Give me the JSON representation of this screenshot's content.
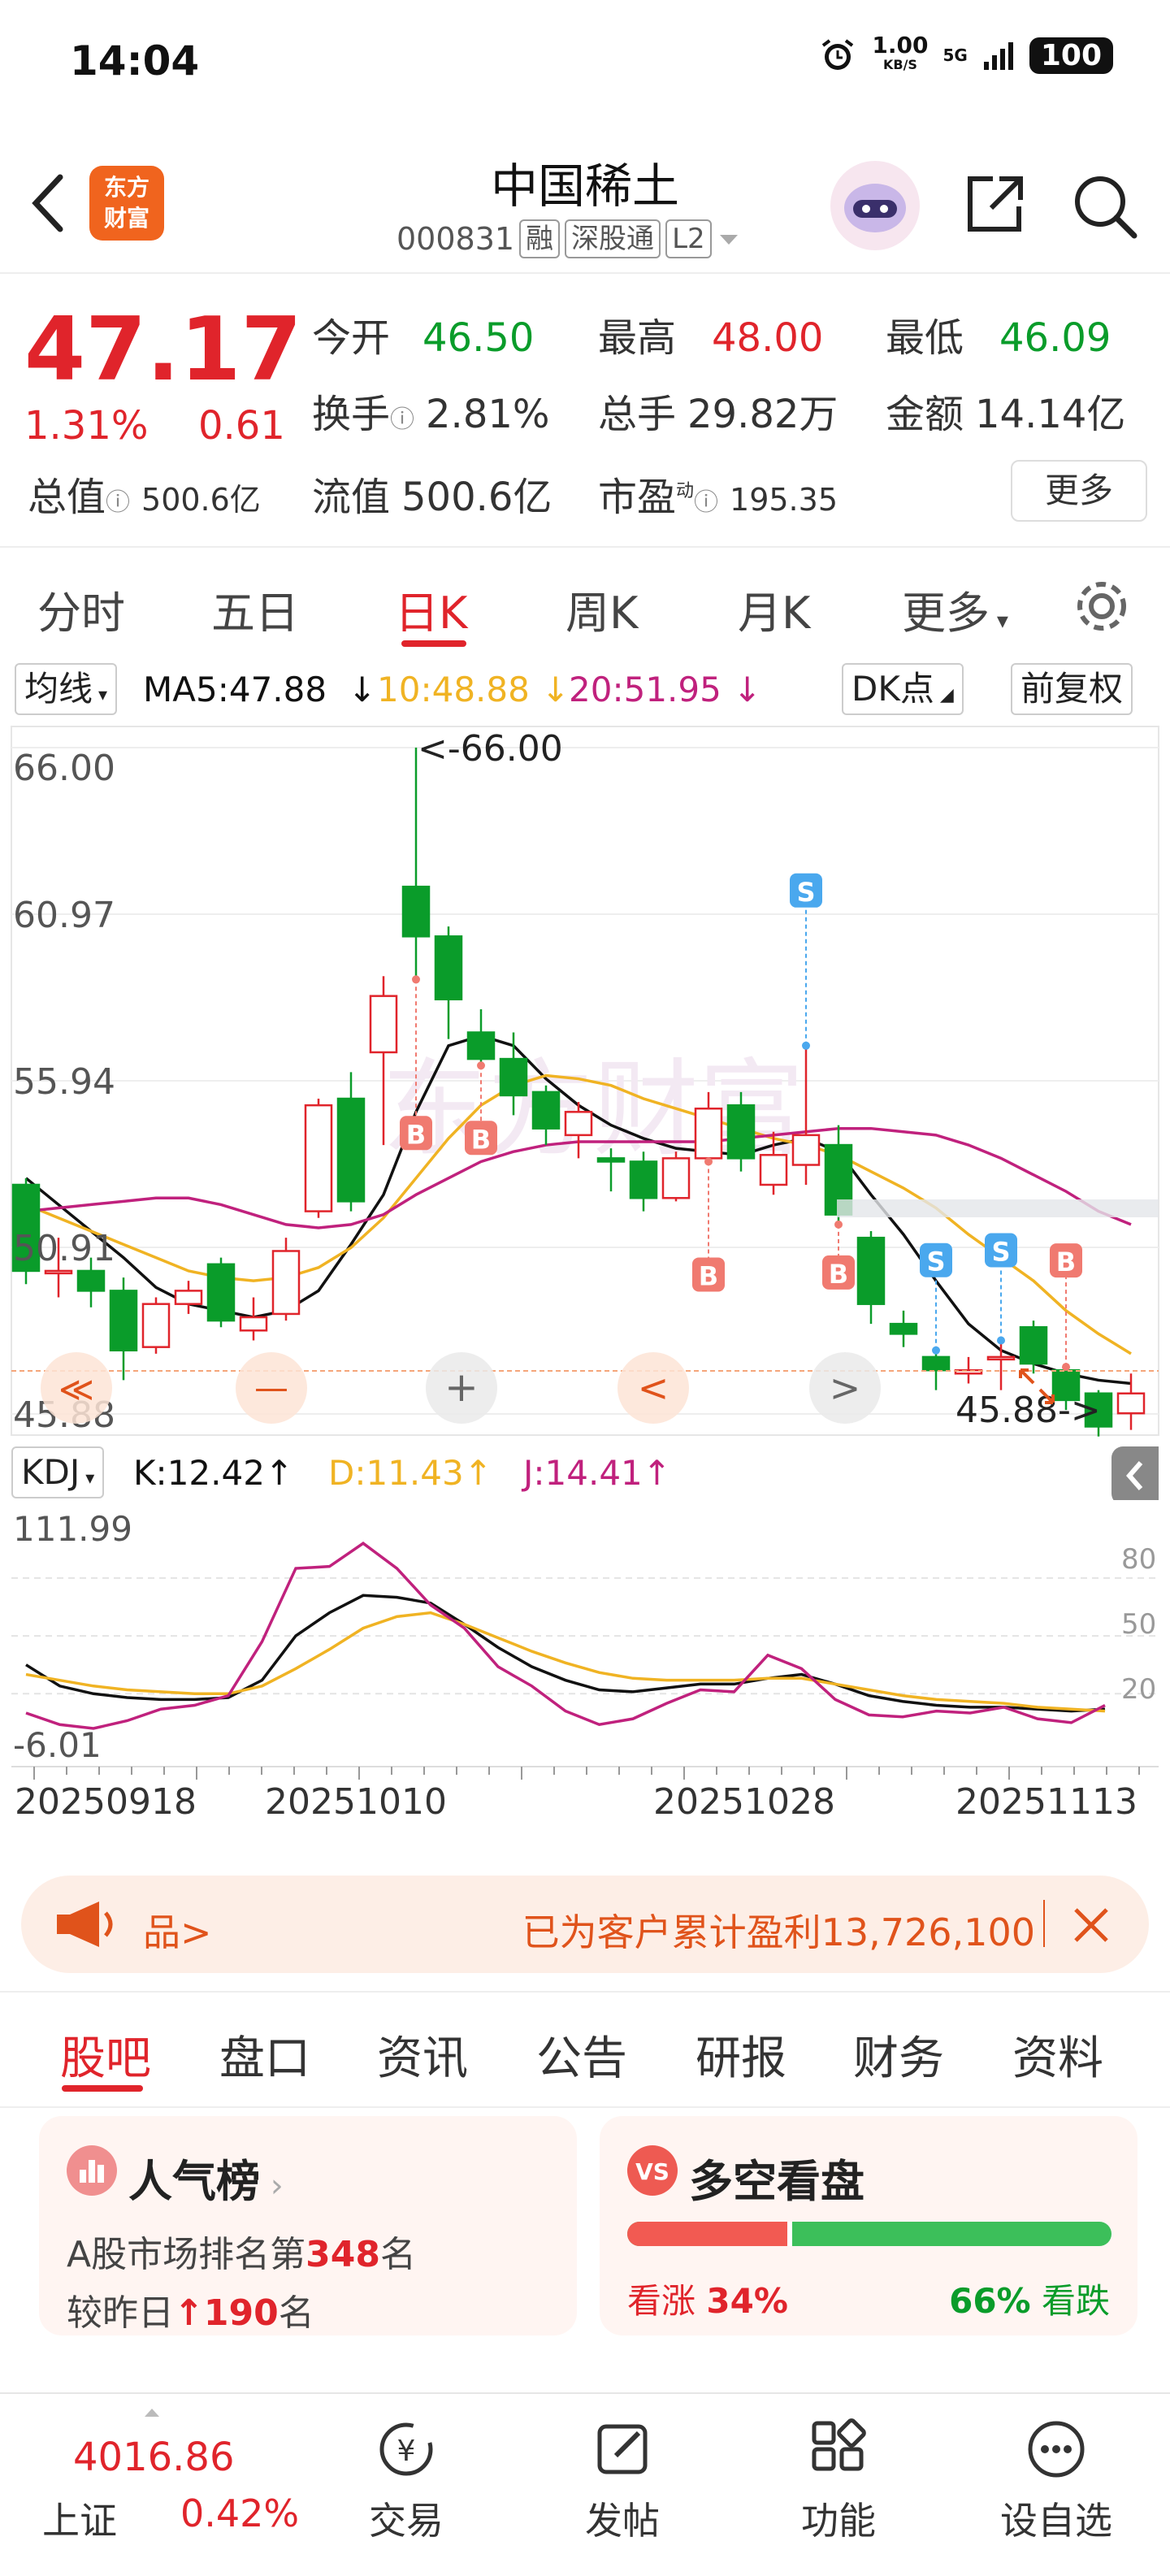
{
  "status_bar": {
    "time": "14:04",
    "net_speed_top": "1.00",
    "net_speed_unit": "KB/S",
    "network": "5G",
    "battery": "100"
  },
  "header": {
    "logo_line1": "东方",
    "logo_line2": "财富",
    "stock_name": "中国稀土",
    "stock_code": "000831",
    "tags": [
      "融",
      "深股通",
      "L2"
    ]
  },
  "quote": {
    "price": "47.17",
    "change_pct": "1.31%",
    "change_amt": "0.61",
    "open_label": "今开",
    "open": "46.50",
    "high_label": "最高",
    "high": "48.00",
    "low_label": "最低",
    "low": "46.09",
    "turnover_label": "换手",
    "turnover": "2.81%",
    "volume_label": "总手",
    "volume": "29.82万",
    "amount_label": "金额",
    "amount": "14.14亿",
    "mktcap_label": "总值",
    "mktcap": "500.6亿",
    "float_label": "流值",
    "float": "500.6亿",
    "pe_label": "市盈",
    "pe_sup": "动",
    "pe": "195.35",
    "more_label": "更多"
  },
  "tabs": [
    "分时",
    "五日",
    "日K",
    "周K",
    "月K",
    "更多"
  ],
  "active_tab": "日K",
  "ma_bar": {
    "dropdown": "均线",
    "ma5": "MA5:47.88",
    "ma10": "10:48.88",
    "ma20": "20:51.95",
    "dk": "DK点",
    "adjust": "前复权"
  },
  "kline": {
    "y_labels": [
      "66.00",
      "60.97",
      "55.94",
      "50.91",
      "45.88"
    ],
    "max_marker": "<-66.00",
    "min_marker": "45.88->",
    "watermark": "东方财富",
    "nav_buttons": [
      "≪",
      "—",
      "+",
      "<",
      ">"
    ]
  },
  "chart_data": [
    {
      "type": "candlestick",
      "title": "",
      "ylim": [
        45.88,
        66.0
      ],
      "dates_shown": [
        "20250918",
        "20251010",
        "20251028",
        "20251113"
      ],
      "candles": [
        {
          "o": 52.8,
          "c": 50.2,
          "h": 53.0,
          "l": 49.8
        },
        {
          "o": 50.2,
          "c": 50.2,
          "h": 51.2,
          "l": 49.4
        },
        {
          "o": 50.2,
          "c": 49.6,
          "h": 50.6,
          "l": 49.1
        },
        {
          "o": 49.6,
          "c": 47.8,
          "h": 50.0,
          "l": 46.9
        },
        {
          "o": 47.9,
          "c": 49.2,
          "h": 49.4,
          "l": 47.7
        },
        {
          "o": 49.2,
          "c": 49.6,
          "h": 49.9,
          "l": 48.9
        },
        {
          "o": 50.4,
          "c": 48.7,
          "h": 50.6,
          "l": 48.5
        },
        {
          "o": 48.4,
          "c": 48.8,
          "h": 49.4,
          "l": 48.1
        },
        {
          "o": 48.9,
          "c": 50.8,
          "h": 51.2,
          "l": 48.7
        },
        {
          "o": 52.0,
          "c": 55.2,
          "h": 55.4,
          "l": 51.8
        },
        {
          "o": 55.4,
          "c": 52.3,
          "h": 56.2,
          "l": 52.0
        },
        {
          "o": 56.8,
          "c": 58.5,
          "h": 59.1,
          "l": 54.0
        },
        {
          "o": 61.8,
          "c": 60.3,
          "h": 66.0,
          "l": 59.0
        },
        {
          "o": 60.3,
          "c": 58.4,
          "h": 60.6,
          "l": 57.2
        },
        {
          "o": 57.4,
          "c": 56.6,
          "h": 58.1,
          "l": 56.4
        },
        {
          "o": 56.6,
          "c": 55.5,
          "h": 57.4,
          "l": 54.9
        },
        {
          "o": 55.6,
          "c": 54.5,
          "h": 55.8,
          "l": 54.0
        },
        {
          "o": 54.3,
          "c": 55.0,
          "h": 55.3,
          "l": 53.6
        },
        {
          "o": 53.6,
          "c": 53.5,
          "h": 53.9,
          "l": 52.6
        },
        {
          "o": 53.5,
          "c": 52.4,
          "h": 53.8,
          "l": 52.0
        },
        {
          "o": 52.4,
          "c": 53.6,
          "h": 53.8,
          "l": 52.3
        },
        {
          "o": 53.6,
          "c": 55.1,
          "h": 55.6,
          "l": 53.5
        },
        {
          "o": 55.2,
          "c": 53.6,
          "h": 55.6,
          "l": 53.2
        },
        {
          "o": 52.8,
          "c": 53.7,
          "h": 54.4,
          "l": 52.5
        },
        {
          "o": 53.4,
          "c": 54.3,
          "h": 57.0,
          "l": 52.8
        },
        {
          "o": 54.0,
          "c": 51.9,
          "h": 54.6,
          "l": 51.6
        },
        {
          "o": 51.2,
          "c": 49.2,
          "h": 51.4,
          "l": 48.6
        },
        {
          "o": 48.6,
          "c": 48.3,
          "h": 49.0,
          "l": 47.9
        },
        {
          "o": 47.6,
          "c": 47.2,
          "h": 47.8,
          "l": 46.6
        },
        {
          "o": 47.1,
          "c": 47.2,
          "h": 47.6,
          "l": 46.8
        },
        {
          "o": 47.6,
          "c": 47.6,
          "h": 48.1,
          "l": 46.6
        },
        {
          "o": 48.5,
          "c": 47.4,
          "h": 48.7,
          "l": 47.1
        },
        {
          "o": 47.2,
          "c": 46.3,
          "h": 47.3,
          "l": 46.0
        },
        {
          "o": 46.5,
          "c": 45.5,
          "h": 46.6,
          "l": 45.2
        },
        {
          "o": 45.9,
          "c": 46.5,
          "h": 47.1,
          "l": 45.4
        }
      ],
      "series": [
        {
          "name": "MA5",
          "color": "#111111",
          "values": [
            53.0,
            52.2,
            51.4,
            50.6,
            49.7,
            49.2,
            49.0,
            48.8,
            49.0,
            49.6,
            51.0,
            52.5,
            55.0,
            57.0,
            57.3,
            57.0,
            56.0,
            55.2,
            54.6,
            54.2,
            53.9,
            53.8,
            53.7,
            54.0,
            54.2,
            53.8,
            52.5,
            51.3,
            49.9,
            48.6,
            47.8,
            47.4,
            47.1,
            46.9,
            46.8
          ]
        },
        {
          "name": "10",
          "color": "#f0b323",
          "values": [
            52.2,
            51.8,
            51.4,
            51.0,
            50.6,
            50.2,
            50.0,
            49.9,
            50.0,
            50.3,
            50.9,
            51.8,
            53.0,
            54.2,
            55.2,
            55.8,
            56.1,
            56.0,
            55.8,
            55.4,
            55.1,
            54.8,
            54.5,
            54.2,
            54.0,
            53.7,
            53.2,
            52.7,
            52.1,
            51.3,
            50.6,
            49.9,
            49.0,
            48.3,
            47.7
          ]
        },
        {
          "name": "20",
          "color": "#c0217d",
          "values": [
            52.0,
            52.1,
            52.2,
            52.3,
            52.4,
            52.4,
            52.2,
            51.9,
            51.6,
            51.5,
            51.6,
            51.9,
            52.5,
            53.0,
            53.5,
            53.8,
            54.0,
            54.1,
            54.1,
            54.1,
            54.1,
            54.1,
            54.2,
            54.3,
            54.4,
            54.5,
            54.5,
            54.4,
            54.3,
            54.0,
            53.6,
            53.1,
            52.6,
            52.0,
            51.6
          ]
        }
      ]
    },
    {
      "type": "line",
      "title": "KDJ",
      "ylim": [
        -6.01,
        111.99
      ],
      "series": [
        {
          "name": "K",
          "color": "#111111",
          "values": [
            35,
            24,
            20,
            18,
            17,
            17,
            18,
            27,
            50,
            62,
            71,
            70,
            67,
            56,
            44,
            34,
            27,
            22,
            21,
            23,
            25,
            25,
            28,
            30,
            25,
            19,
            16,
            14,
            13,
            13,
            12,
            11,
            12
          ]
        },
        {
          "name": "D",
          "color": "#f0b323",
          "values": [
            30,
            27,
            24,
            22,
            21,
            20,
            20,
            24,
            33,
            43,
            54,
            60,
            62,
            56,
            49,
            42,
            36,
            31,
            28,
            27,
            27,
            27,
            28,
            28,
            25,
            22,
            19,
            17,
            16,
            15,
            13,
            12,
            11
          ]
        },
        {
          "name": "J",
          "color": "#c0217d",
          "values": [
            10,
            4,
            2,
            6,
            12,
            14,
            19,
            47,
            85,
            86,
            98,
            85,
            66,
            54,
            34,
            24,
            11,
            4,
            7,
            15,
            22,
            21,
            40,
            33,
            17,
            9,
            8,
            11,
            10,
            13,
            7,
            5,
            14
          ]
        }
      ]
    }
  ],
  "kdj_bar": {
    "dropdown": "KDJ",
    "k": "K:12.42↑",
    "d": "D:11.43↑",
    "j": "J:14.41↑",
    "y_top": "111.99",
    "y_bottom": "-6.01",
    "levels": [
      "80",
      "50",
      "20"
    ]
  },
  "banner": {
    "left_text": "品>",
    "right_text": "已为客户累计盈利13,726,100"
  },
  "content_tabs": [
    "股吧",
    "盘口",
    "资讯",
    "公告",
    "研报",
    "财务",
    "资料"
  ],
  "popularity_card": {
    "title": "人气榜",
    "line1_prefix": "A股市场排名第",
    "rank": "348",
    "line1_suffix": "名",
    "line2_prefix": "较昨日",
    "change": "↑190",
    "line2_suffix": "名"
  },
  "sentiment_card": {
    "title": "多空看盘",
    "up_label": "看涨",
    "up_pct": "34%",
    "down_pct": "66%",
    "down_label": "看跌",
    "up_fraction": 0.34
  },
  "bottom_nav": {
    "index_value": "4016.86",
    "index_name": "上证",
    "index_change": "0.42%",
    "items": [
      "交易",
      "发帖",
      "功能",
      "设自选"
    ]
  }
}
